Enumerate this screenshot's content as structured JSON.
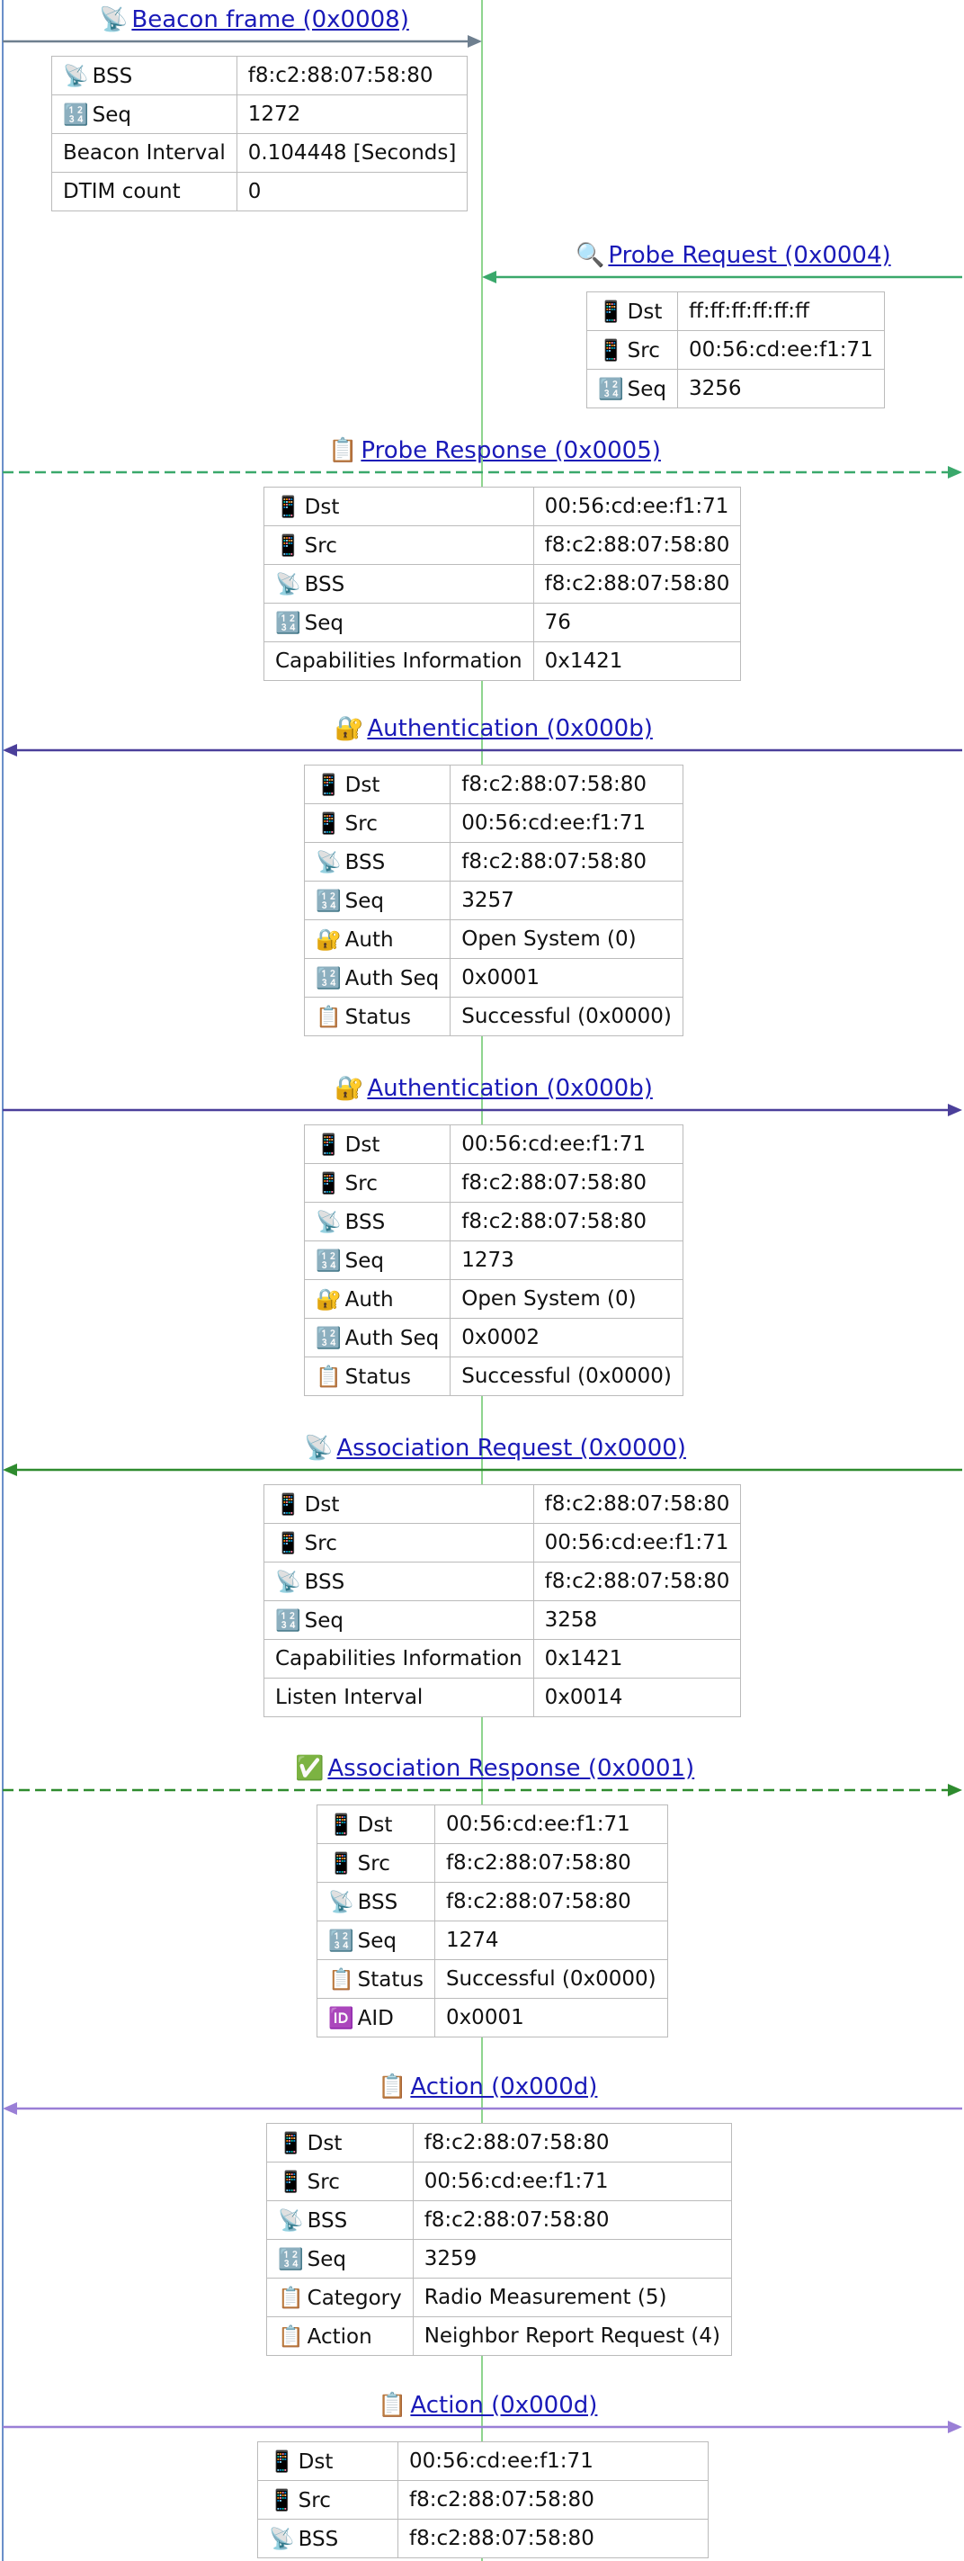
{
  "colors": {
    "client_lifeline": "#6a8fc9",
    "ap_lifeline": "#8fd58f",
    "link": "#1a1ab8"
  },
  "messages": [
    {
      "icon": "📡",
      "icon_name": "satellite-icon",
      "title": "Beacon frame (0x0008)",
      "direction": "right",
      "line_color": "#6e7f8f",
      "dashed": false,
      "end": "ap",
      "fields": [
        {
          "icon": "📡",
          "icon_name": "satellite-icon",
          "key": "BSS",
          "value": "f8:c2:88:07:58:80"
        },
        {
          "icon": "🔢",
          "icon_name": "numbers-icon",
          "key": "Seq",
          "value": "1272"
        },
        {
          "icon": "",
          "icon_name": "",
          "key": "Beacon Interval",
          "value": "0.104448 [Seconds]"
        },
        {
          "icon": "",
          "icon_name": "",
          "key": "DTIM count",
          "value": "0"
        }
      ]
    },
    {
      "icon": "🔍",
      "icon_name": "magnifier-icon",
      "title": "Probe Request (0x0004)",
      "direction": "left",
      "line_color": "#3aa86b",
      "dashed": false,
      "end": "ap",
      "fields": [
        {
          "icon": "📱",
          "icon_name": "phone-icon",
          "key": "Dst",
          "value": "ff:ff:ff:ff:ff:ff"
        },
        {
          "icon": "📱",
          "icon_name": "phone-icon",
          "key": "Src",
          "value": "00:56:cd:ee:f1:71"
        },
        {
          "icon": "🔢",
          "icon_name": "numbers-icon",
          "key": "Seq",
          "value": "3256"
        }
      ]
    },
    {
      "icon": "📋",
      "icon_name": "clipboard-icon",
      "title": "Probe Response (0x0005)",
      "direction": "right",
      "line_color": "#3aa86b",
      "dashed": true,
      "end": "edge",
      "fields": [
        {
          "icon": "📱",
          "icon_name": "phone-icon",
          "key": "Dst",
          "value": "00:56:cd:ee:f1:71"
        },
        {
          "icon": "📱",
          "icon_name": "phone-icon",
          "key": "Src",
          "value": "f8:c2:88:07:58:80"
        },
        {
          "icon": "📡",
          "icon_name": "satellite-icon",
          "key": "BSS",
          "value": "f8:c2:88:07:58:80"
        },
        {
          "icon": "🔢",
          "icon_name": "numbers-icon",
          "key": "Seq",
          "value": "76"
        },
        {
          "icon": "",
          "icon_name": "",
          "key": "Capabilities Information",
          "value": "0x1421"
        }
      ]
    },
    {
      "icon": "🔐",
      "icon_name": "lock-key-icon",
      "title": "Authentication (0x000b)",
      "direction": "left",
      "line_color": "#4b3f9a",
      "dashed": false,
      "end": "edge",
      "fields": [
        {
          "icon": "📱",
          "icon_name": "phone-icon",
          "key": "Dst",
          "value": "f8:c2:88:07:58:80"
        },
        {
          "icon": "📱",
          "icon_name": "phone-icon",
          "key": "Src",
          "value": "00:56:cd:ee:f1:71"
        },
        {
          "icon": "📡",
          "icon_name": "satellite-icon",
          "key": "BSS",
          "value": "f8:c2:88:07:58:80"
        },
        {
          "icon": "🔢",
          "icon_name": "numbers-icon",
          "key": "Seq",
          "value": "3257"
        },
        {
          "icon": "🔐",
          "icon_name": "lock-key-icon",
          "key": "Auth",
          "value": "Open System (0)"
        },
        {
          "icon": "🔢",
          "icon_name": "numbers-icon",
          "key": "Auth Seq",
          "value": "0x0001"
        },
        {
          "icon": "📋",
          "icon_name": "clipboard-icon",
          "key": "Status",
          "value": "Successful (0x0000)"
        }
      ]
    },
    {
      "icon": "🔐",
      "icon_name": "lock-key-icon",
      "title": "Authentication (0x000b)",
      "direction": "right",
      "line_color": "#4b3f9a",
      "dashed": false,
      "end": "edge",
      "fields": [
        {
          "icon": "📱",
          "icon_name": "phone-icon",
          "key": "Dst",
          "value": "00:56:cd:ee:f1:71"
        },
        {
          "icon": "📱",
          "icon_name": "phone-icon",
          "key": "Src",
          "value": "f8:c2:88:07:58:80"
        },
        {
          "icon": "📡",
          "icon_name": "satellite-icon",
          "key": "BSS",
          "value": "f8:c2:88:07:58:80"
        },
        {
          "icon": "🔢",
          "icon_name": "numbers-icon",
          "key": "Seq",
          "value": "1273"
        },
        {
          "icon": "🔐",
          "icon_name": "lock-key-icon",
          "key": "Auth",
          "value": "Open System (0)"
        },
        {
          "icon": "🔢",
          "icon_name": "numbers-icon",
          "key": "Auth Seq",
          "value": "0x0002"
        },
        {
          "icon": "📋",
          "icon_name": "clipboard-icon",
          "key": "Status",
          "value": "Successful (0x0000)"
        }
      ]
    },
    {
      "icon": "📡",
      "icon_name": "satellite-icon",
      "title": "Association Request (0x0000)",
      "direction": "left",
      "line_color": "#2e8b2e",
      "dashed": false,
      "end": "edge",
      "fields": [
        {
          "icon": "📱",
          "icon_name": "phone-icon",
          "key": "Dst",
          "value": "f8:c2:88:07:58:80"
        },
        {
          "icon": "📱",
          "icon_name": "phone-icon",
          "key": "Src",
          "value": "00:56:cd:ee:f1:71"
        },
        {
          "icon": "📡",
          "icon_name": "satellite-icon",
          "key": "BSS",
          "value": "f8:c2:88:07:58:80"
        },
        {
          "icon": "🔢",
          "icon_name": "numbers-icon",
          "key": "Seq",
          "value": "3258"
        },
        {
          "icon": "",
          "icon_name": "",
          "key": "Capabilities Information",
          "value": "0x1421"
        },
        {
          "icon": "",
          "icon_name": "",
          "key": "Listen Interval",
          "value": "0x0014"
        }
      ]
    },
    {
      "icon": "✅",
      "icon_name": "check-mark-icon",
      "title": "Association Response (0x0001)",
      "direction": "right",
      "line_color": "#2e8b2e",
      "dashed": true,
      "end": "edge",
      "fields": [
        {
          "icon": "📱",
          "icon_name": "phone-icon",
          "key": "Dst",
          "value": "00:56:cd:ee:f1:71"
        },
        {
          "icon": "📱",
          "icon_name": "phone-icon",
          "key": "Src",
          "value": "f8:c2:88:07:58:80"
        },
        {
          "icon": "📡",
          "icon_name": "satellite-icon",
          "key": "BSS",
          "value": "f8:c2:88:07:58:80"
        },
        {
          "icon": "🔢",
          "icon_name": "numbers-icon",
          "key": "Seq",
          "value": "1274"
        },
        {
          "icon": "📋",
          "icon_name": "clipboard-icon",
          "key": "Status",
          "value": "Successful (0x0000)"
        },
        {
          "icon": "🆔",
          "icon_name": "id-icon",
          "key": "AID",
          "value": "0x0001"
        }
      ]
    },
    {
      "icon": "📋",
      "icon_name": "clipboard-icon",
      "title": "Action (0x000d)",
      "direction": "left",
      "line_color": "#9a7fd6",
      "dashed": false,
      "end": "edge",
      "fields": [
        {
          "icon": "📱",
          "icon_name": "phone-icon",
          "key": "Dst",
          "value": "f8:c2:88:07:58:80"
        },
        {
          "icon": "📱",
          "icon_name": "phone-icon",
          "key": "Src",
          "value": "00:56:cd:ee:f1:71"
        },
        {
          "icon": "📡",
          "icon_name": "satellite-icon",
          "key": "BSS",
          "value": "f8:c2:88:07:58:80"
        },
        {
          "icon": "🔢",
          "icon_name": "numbers-icon",
          "key": "Seq",
          "value": "3259"
        },
        {
          "icon": "📋",
          "icon_name": "clipboard-icon",
          "key": "Category",
          "value": "Radio Measurement (5)"
        },
        {
          "icon": "📋",
          "icon_name": "clipboard-icon",
          "key": "Action",
          "value": "Neighbor Report Request (4)"
        }
      ]
    },
    {
      "icon": "📋",
      "icon_name": "clipboard-icon",
      "title": "Action (0x000d)",
      "direction": "right",
      "line_color": "#9a7fd6",
      "dashed": false,
      "end": "edge",
      "fields": [
        {
          "icon": "📱",
          "icon_name": "phone-icon",
          "key": "Dst",
          "value": "00:56:cd:ee:f1:71"
        },
        {
          "icon": "📱",
          "icon_name": "phone-icon",
          "key": "Src",
          "value": "f8:c2:88:07:58:80"
        },
        {
          "icon": "📡",
          "icon_name": "satellite-icon",
          "key": "BSS",
          "value": "f8:c2:88:07:58:80"
        }
      ]
    }
  ]
}
